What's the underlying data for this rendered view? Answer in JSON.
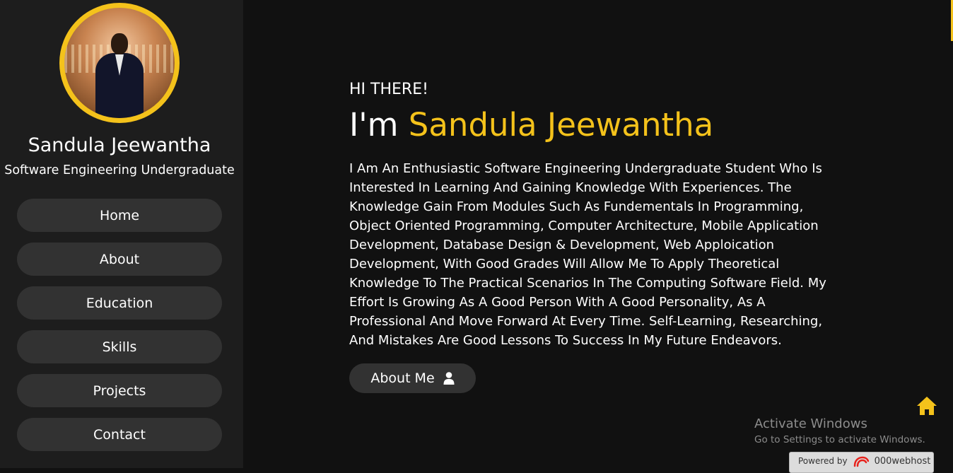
{
  "profile": {
    "name": "Sandula Jeewantha",
    "role": "Software Engineering Undergraduate"
  },
  "nav": {
    "items": [
      {
        "label": "Home"
      },
      {
        "label": "About"
      },
      {
        "label": "Education"
      },
      {
        "label": "Skills"
      },
      {
        "label": "Projects"
      },
      {
        "label": "Contact"
      }
    ]
  },
  "hero": {
    "greeting": "HI THERE!",
    "heading_prefix": "I'm ",
    "heading_name": "Sandula Jeewantha",
    "bio": "I Am An Enthusiastic Software Engineering Undergraduate Student Who Is Interested In Learning And Gaining Knowledge With Experiences. The Knowledge Gain From Modules Such As Fundementals In Programming, Object Oriented Programming, Computer Architecture, Mobile Application Development, Database Design & Development, Web Apploication Development, With Good Grades Will Allow Me To Apply Theoretical Knowledge To The Practical Scenarios In The Computing Software Field. My Effort Is Growing As A Good Person With A Good Personality, As A Professional And Move Forward At Every Time. Self-Learning, Researching, And Mistakes Are Good Lessons To Success In My Future Endeavors.",
    "button_label": "About Me",
    "button_icon": "user-icon"
  },
  "floating": {
    "home_icon": "home-icon"
  },
  "windows_watermark": {
    "title": "Activate Windows",
    "subtitle": "Go to Settings to activate Windows."
  },
  "host_badge": {
    "prefix": "Powered by",
    "brand": "000webhost"
  },
  "colors": {
    "accent": "#f4c21b",
    "background": "#111111",
    "sidebar": "#1d1d1d",
    "button": "#323232"
  }
}
